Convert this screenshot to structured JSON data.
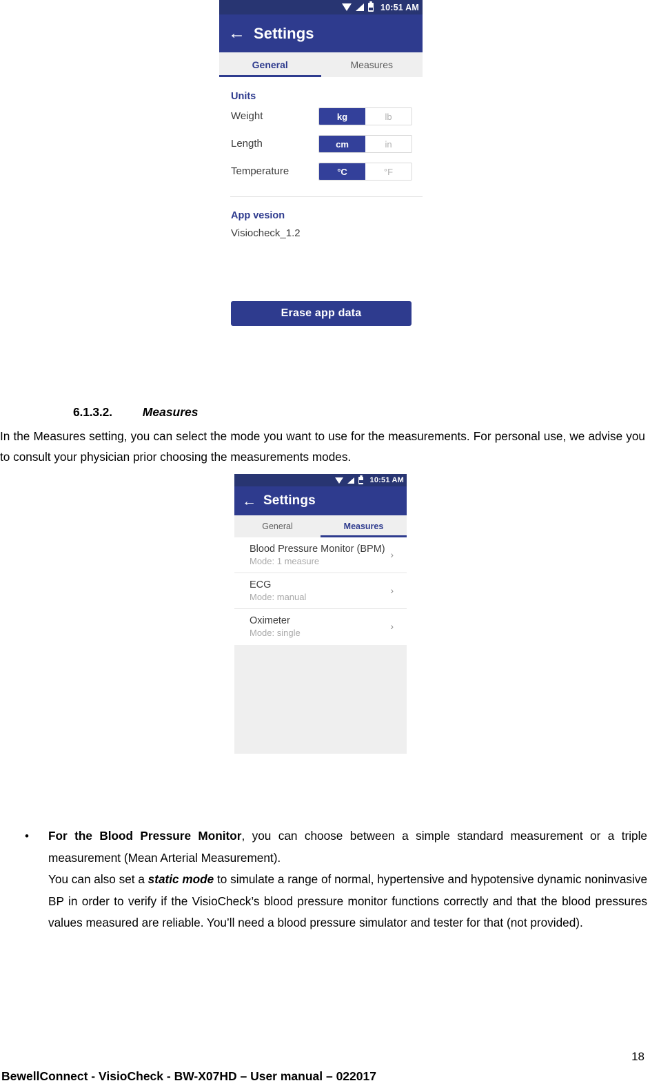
{
  "document": {
    "heading": {
      "number": "6.1.3.2.",
      "title": "Measures"
    },
    "intro_paragraph": "In the Measures setting, you can select the mode you want to use for the measurements. For personal use, we advise you to consult your physician prior choosing the measurements modes.",
    "bullet": {
      "marker": "•",
      "lead_bold": "For the Blood Pressure Monitor",
      "line1_rest": ", you can choose between a simple standard measurement or a triple measurement (Mean Arterial Measurement).",
      "line2_pre": "You can also set a ",
      "line2_emphasis": "static mode",
      "line2_rest": " to simulate a range of normal, hypertensive and hypotensive dynamic noninvasive BP in order to verify if the VisioCheck’s blood pressure monitor functions correctly and that the blood pressures values measured are reliable.  You’ll need a blood pressure simulator and tester for that (not provided)."
    },
    "footer": {
      "page_number": "18",
      "text": "BewellConnect - VisioCheck - BW-X07HD – User manual – 022017"
    }
  },
  "screenshot_general": {
    "status_bar": {
      "time": "10:51 AM",
      "icons": [
        "wifi-icon",
        "signal-icon",
        "battery-icon"
      ]
    },
    "app_bar": {
      "back_icon": "back-arrow-icon",
      "title": "Settings"
    },
    "tabs": [
      {
        "label": "General",
        "active": true
      },
      {
        "label": "Measures",
        "active": false
      }
    ],
    "units": {
      "section_title": "Units",
      "rows": [
        {
          "label": "Weight",
          "options": [
            "kg",
            "lb"
          ],
          "selected": "kg"
        },
        {
          "label": "Length",
          "options": [
            "cm",
            "in"
          ],
          "selected": "cm"
        },
        {
          "label": "Temperature",
          "options": [
            "°C",
            "°F"
          ],
          "selected": "°C"
        }
      ]
    },
    "app_version": {
      "section_title": "App vesion",
      "value": "Visiocheck_1.2"
    },
    "erase_button": "Erase app data",
    "colors": {
      "status_bar": "#283572",
      "app_bar": "#2e3b8e",
      "accent": "#2e3b8e",
      "tab_bar": "#efefef",
      "segment_selected": "#33409a"
    }
  },
  "screenshot_measures": {
    "status_bar": {
      "time": "10:51 AM",
      "icons": [
        "wifi-icon",
        "signal-icon",
        "battery-icon"
      ]
    },
    "app_bar": {
      "back_icon": "back-arrow-icon",
      "title": "Settings"
    },
    "tabs": [
      {
        "label": "General",
        "active": false
      },
      {
        "label": "Measures",
        "active": true
      }
    ],
    "list": [
      {
        "title": "Blood Pressure Monitor (BPM)",
        "subtitle": "Mode: 1 measure",
        "chevron": "›"
      },
      {
        "title": "ECG",
        "subtitle": "Mode: manual",
        "chevron": "›"
      },
      {
        "title": "Oximeter",
        "subtitle": "Mode: single",
        "chevron": "›"
      }
    ],
    "colors": {
      "status_bar": "#283572",
      "app_bar": "#2e3b8e",
      "accent": "#2e3b8e",
      "empty_panel": "#efefef"
    }
  }
}
